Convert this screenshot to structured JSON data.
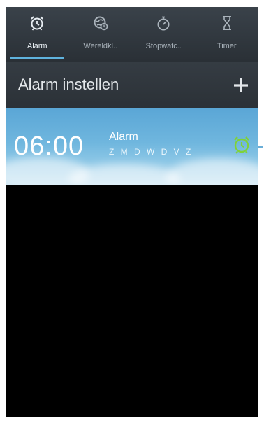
{
  "tabs": [
    {
      "label": "Alarm",
      "icon": "alarm-clock-icon",
      "active": true
    },
    {
      "label": "Wereldkl..",
      "icon": "world-clock-icon",
      "active": false
    },
    {
      "label": "Stopwatc..",
      "icon": "stopwatch-icon",
      "active": false
    },
    {
      "label": "Timer",
      "icon": "hourglass-icon",
      "active": false
    }
  ],
  "header": {
    "title": "Alarm instellen",
    "add_icon": "plus-icon"
  },
  "alarms": [
    {
      "time": "06:00",
      "name": "Alarm",
      "days": "Z M D W D V Z",
      "toggle_icon": "alarm-on-icon"
    }
  ],
  "colors": {
    "tab_accent": "#5fb3de",
    "alarm_on": "#7fd23a",
    "background": "#000000"
  }
}
